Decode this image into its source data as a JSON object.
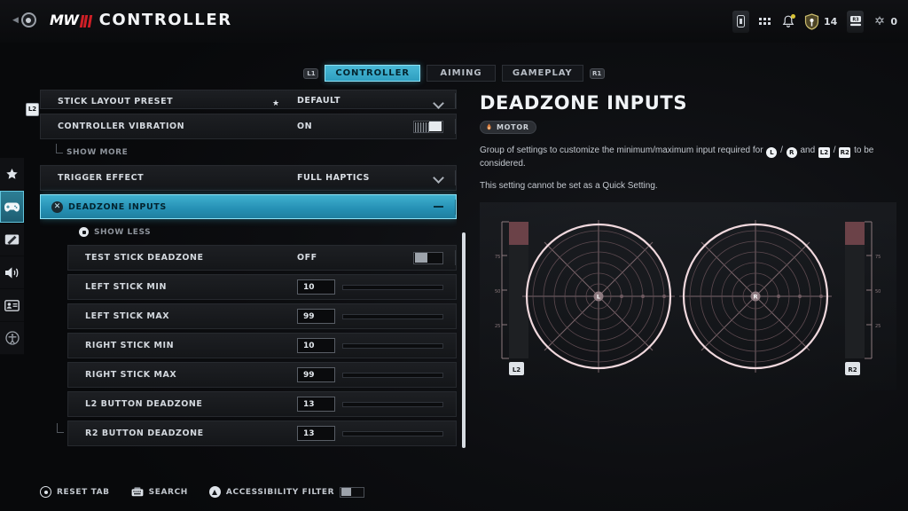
{
  "header": {
    "back_icon": "r3-back-icon",
    "logo": "mw3-logo",
    "logo_text": "MW",
    "title": "CONTROLLER"
  },
  "hud": {
    "items": [
      {
        "icon": "battery-icon",
        "label": ""
      },
      {
        "icon": "grid-menu-icon",
        "label": ""
      },
      {
        "icon": "bell-notification-icon",
        "label": ""
      },
      {
        "icon": "shield-emblem-icon",
        "label": "14"
      },
      {
        "icon": "r3-key-icon",
        "label": ""
      },
      {
        "icon": "network-icon",
        "label": "0"
      }
    ]
  },
  "tabs": {
    "left_bumper": "L1",
    "right_bumper": "R1",
    "items": [
      {
        "label": "CONTROLLER",
        "active": true
      },
      {
        "label": "AIMING",
        "active": false
      },
      {
        "label": "GAMEPLAY",
        "active": false
      }
    ]
  },
  "sidebar": {
    "hint_button": "L2",
    "items": [
      {
        "icon": "star-icon",
        "label": "Favorites",
        "active": false
      },
      {
        "icon": "gamepad-icon",
        "label": "Controller",
        "active": true
      },
      {
        "icon": "display-icon",
        "label": "Graphics",
        "active": false
      },
      {
        "icon": "speaker-icon",
        "label": "Audio",
        "active": false
      },
      {
        "icon": "account-card-icon",
        "label": "Account",
        "active": false
      },
      {
        "icon": "accessibility-icon",
        "label": "Accessibility",
        "active": false
      }
    ]
  },
  "settings": {
    "rows": [
      {
        "type": "dropdown",
        "label": "STICK LAYOUT PRESET",
        "value": "DEFAULT",
        "starred": true,
        "clipped": true
      },
      {
        "type": "toggle",
        "label": "CONTROLLER VIBRATION",
        "value": "ON",
        "toggle_state": "on"
      },
      {
        "type": "sublink",
        "label": "SHOW MORE",
        "icon": "corner-bracket-icon"
      },
      {
        "type": "dropdown",
        "label": "TRIGGER EFFECT",
        "value": "FULL HAPTICS"
      },
      {
        "type": "section",
        "label": "DEADZONE INPUTS",
        "selected": true,
        "close_icon": "close-x-icon",
        "collapse_icon": "minus-icon"
      },
      {
        "type": "sublink-deep",
        "label": "SHOW LESS",
        "icon": "collapse-square-icon"
      },
      {
        "type": "toggle",
        "label": "TEST STICK DEADZONE",
        "value": "OFF",
        "toggle_state": "off",
        "indent": true
      },
      {
        "type": "slider",
        "label": "LEFT STICK MIN",
        "value": "10",
        "percent": 10,
        "indent": true
      },
      {
        "type": "slider",
        "label": "LEFT STICK MAX",
        "value": "99",
        "percent": 99,
        "indent": true
      },
      {
        "type": "slider",
        "label": "RIGHT STICK MIN",
        "value": "10",
        "percent": 10,
        "indent": true
      },
      {
        "type": "slider",
        "label": "RIGHT STICK MAX",
        "value": "99",
        "percent": 99,
        "indent": true
      },
      {
        "type": "slider",
        "label": "L2 BUTTON DEADZONE",
        "value": "13",
        "percent": 13,
        "indent": true
      },
      {
        "type": "slider",
        "label": "R2 BUTTON DEADZONE",
        "value": "13",
        "percent": 13,
        "indent": true
      }
    ]
  },
  "panel": {
    "title": "DEADZONE INPUTS",
    "badge": {
      "icon": "motor-icon",
      "label": "MOTOR"
    },
    "description_part1": "Group of settings to customize the minimum/maximum input required for",
    "glyph_l": "L",
    "glyph_slash1": "/",
    "glyph_r": "R",
    "glyph_and": "and",
    "glyph_l2": "L2",
    "glyph_slash2": "/",
    "glyph_r2": "R2",
    "description_part2": "to be considered.",
    "note": "This setting cannot be set as a Quick Setting."
  },
  "visualizer": {
    "left_stick": {
      "center_glyph": "L",
      "trigger_label": "L2",
      "trigger_side": "left"
    },
    "right_stick": {
      "center_glyph": "R",
      "trigger_label": "R2",
      "trigger_side": "right"
    },
    "scale_ticks": [
      "75",
      "50",
      "25"
    ],
    "ring_color": "#f0d8dd",
    "grid_color": "#6e5a60",
    "trigger_fill_color": "#6b4248"
  },
  "bottombar": {
    "items": [
      {
        "icon": "r3-button-icon",
        "label": "RESET TAB",
        "toggle": false
      },
      {
        "icon": "keyboard-icon",
        "label": "SEARCH",
        "toggle": false
      },
      {
        "icon": "triangle-button-icon",
        "label": "ACCESSIBILITY FILTER",
        "toggle": true
      }
    ]
  },
  "colors": {
    "accent": "#3fb0cf",
    "accent_border": "#8fe2f5",
    "brand_red": "#cf1f26",
    "background": "#08090b"
  }
}
